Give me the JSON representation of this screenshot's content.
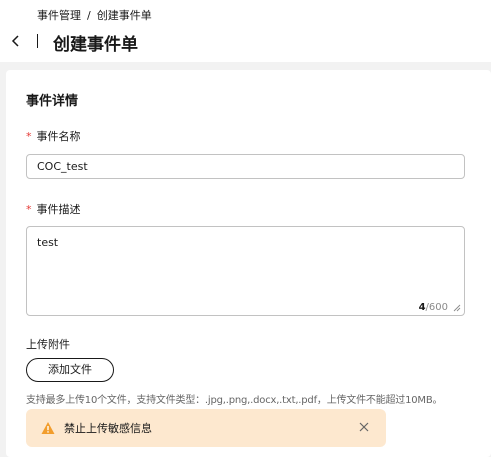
{
  "breadcrumb": {
    "parent": "事件管理",
    "separator": "/",
    "current": "创建事件单"
  },
  "header": {
    "title": "创建事件单",
    "back_icon": "chevron-left-icon"
  },
  "form": {
    "section_title": "事件详情",
    "required_mark": "*",
    "name": {
      "label": "事件名称",
      "value": "COC_test"
    },
    "description": {
      "label": "事件描述",
      "value": "test",
      "count_current": "4",
      "count_max": "/600"
    },
    "attachment": {
      "label": "上传附件",
      "button_label": "添加文件",
      "hint": "支持最多上传10个文件，支持文件类型：.jpg,.png,.docx,.txt,.pdf，上传文件不能超过10MB。"
    },
    "warning": {
      "text": "禁止上传敏感信息",
      "icon": "warning-icon",
      "close_icon": "close-icon"
    }
  },
  "colors": {
    "required": "#e53935",
    "warning_bg": "#fde8cf",
    "warning_icon": "#f29d2c",
    "page_bg": "#f2f2f2"
  }
}
